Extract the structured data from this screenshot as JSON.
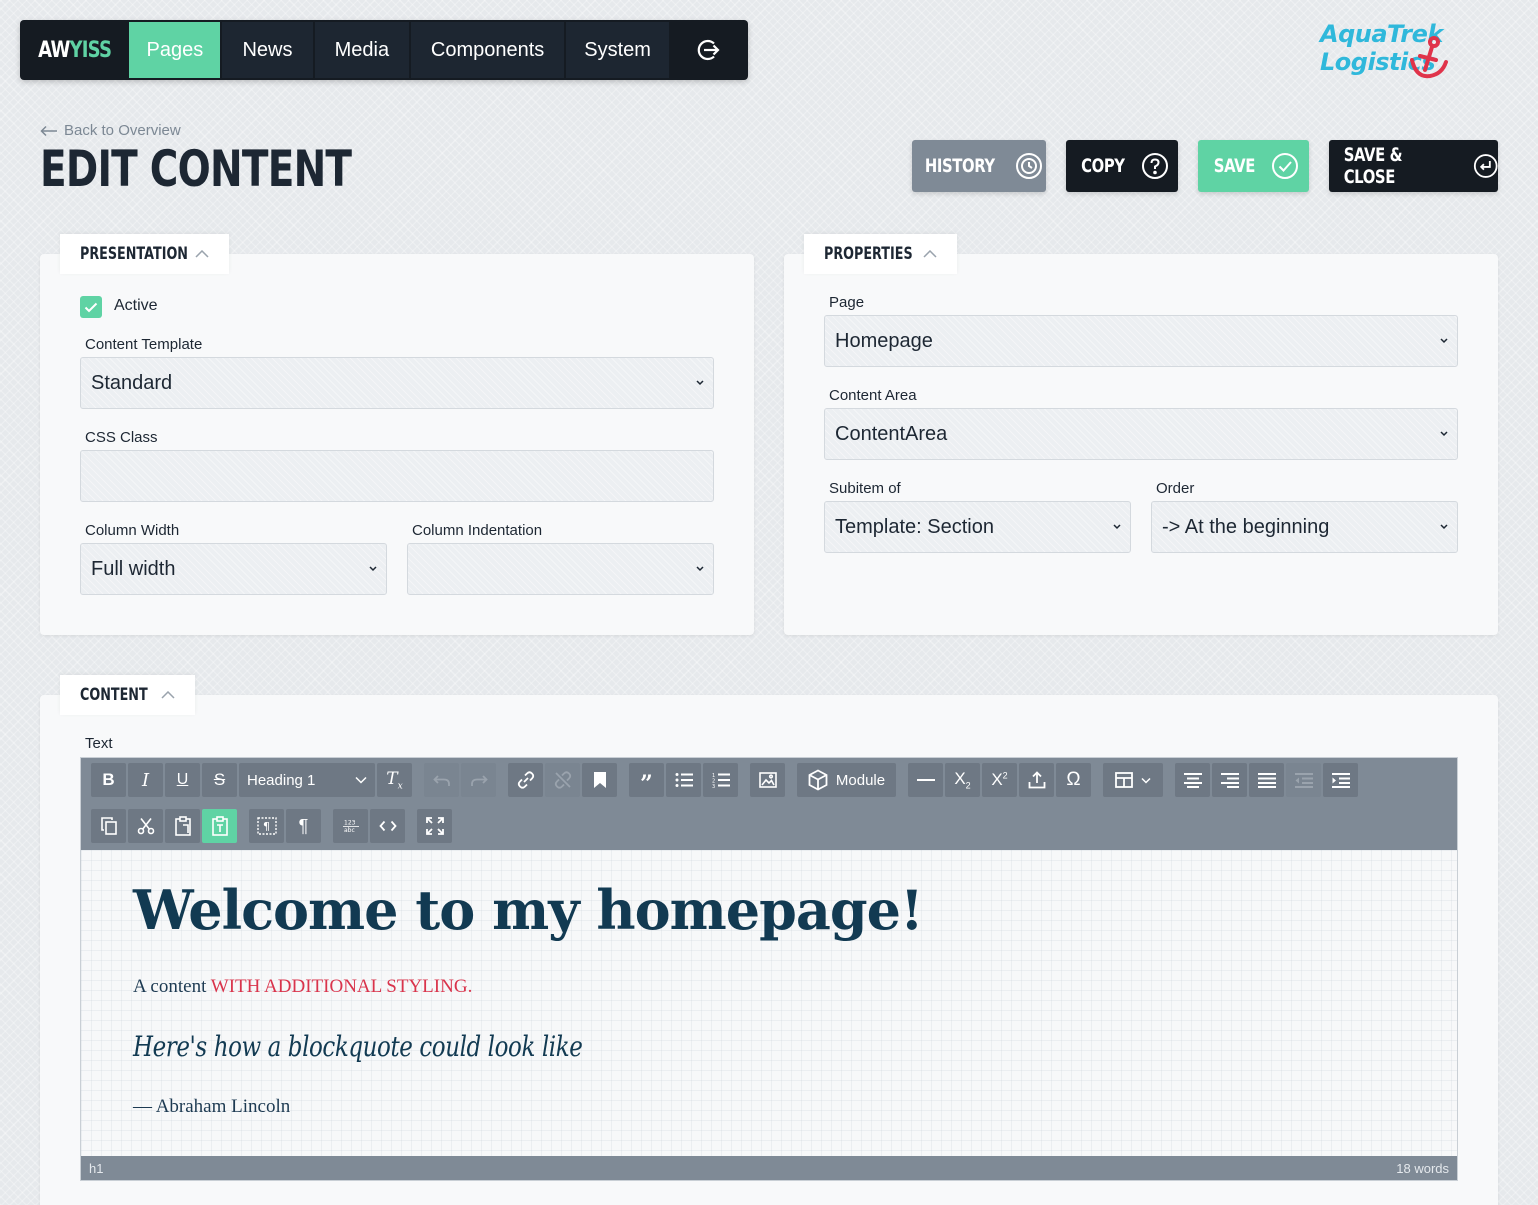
{
  "nav": {
    "brand_a": "AW",
    "brand_b": "YISS",
    "items": [
      {
        "label": "Pages",
        "active": true
      },
      {
        "label": "News"
      },
      {
        "label": "Media"
      },
      {
        "label": "Components"
      },
      {
        "label": "System"
      }
    ],
    "exit_icon": "logout-icon"
  },
  "logo": {
    "text": "AquaTrek Logistics",
    "icon": "anchor-icon"
  },
  "header": {
    "back_label": "Back to Overview",
    "title": "Edit Content",
    "buttons": {
      "history": "History",
      "copy": "Copy",
      "save": "Save",
      "save_close": "Save & Close"
    }
  },
  "presentation": {
    "tab": "Presentation",
    "active_label": "Active",
    "active": true,
    "template_label": "Content Template",
    "template_value": "Standard",
    "css_label": "CSS Class",
    "css_value": "",
    "width_label": "Column Width",
    "width_value": "Full width",
    "indent_label": "Column Indentation",
    "indent_value": ""
  },
  "properties": {
    "tab": "Properties",
    "page_label": "Page",
    "page_value": "Homepage",
    "area_label": "Content Area",
    "area_value": "ContentArea",
    "subitem_label": "Subitem of",
    "subitem_value": "Template: Section",
    "order_label": "Order",
    "order_value": "-> At the beginning"
  },
  "content": {
    "tab": "Content",
    "text_label": "Text",
    "toolbar": {
      "format_value": "Heading 1",
      "module_label": "Module"
    },
    "body": {
      "heading": "Welcome to my homepage!",
      "para_plain": "A content ",
      "para_styled": "with additional styling.",
      "quote": "Here's how a blockquote could look like",
      "cite": "— Abraham Lincoln"
    },
    "status_path": "h1",
    "status_words": "18 words"
  },
  "colors": {
    "accent": "#5fd3a4",
    "dark": "#151b22",
    "gray_button": "#7f8a96",
    "heading_blue": "#123a52",
    "styled_red": "#d9344c",
    "logo_blue": "#2fb8db",
    "logo_red": "#e0334a"
  }
}
